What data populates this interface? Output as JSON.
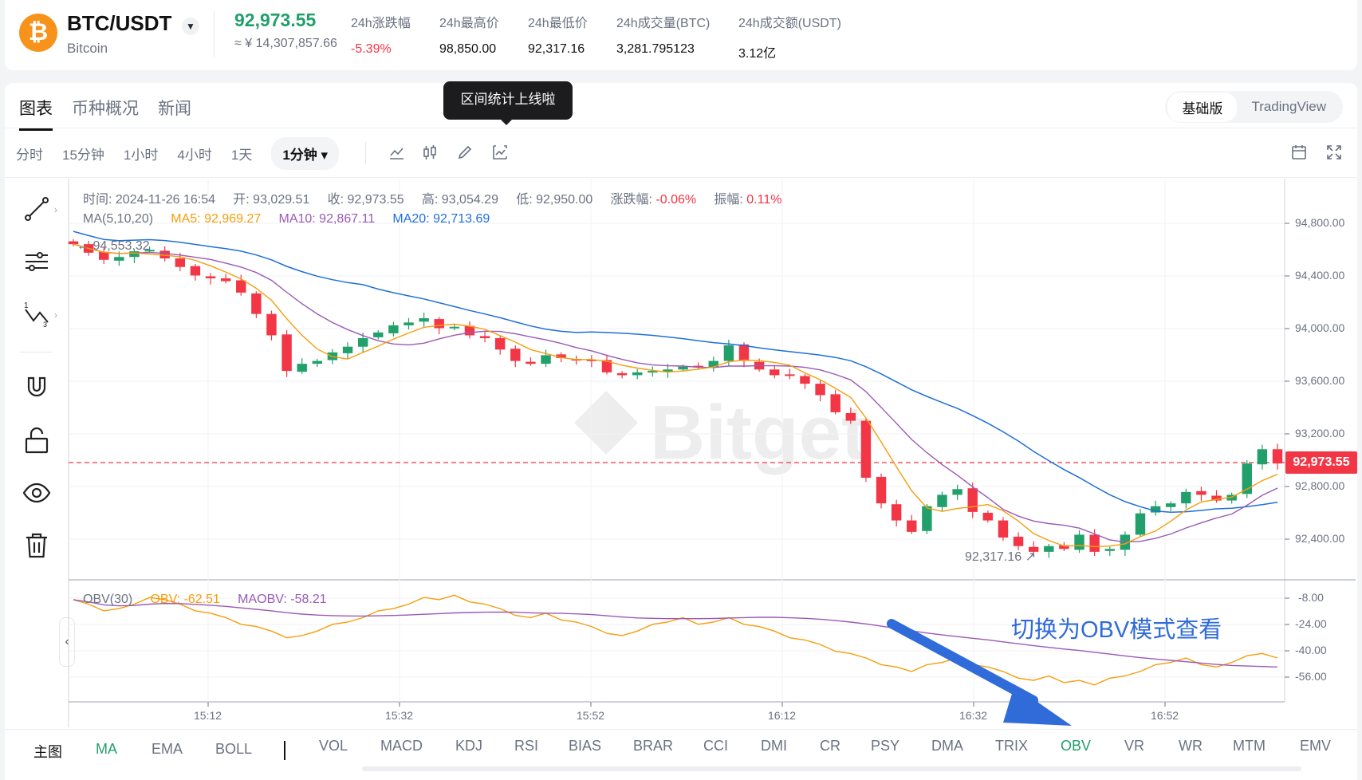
{
  "header": {
    "pair": "BTC/USDT",
    "coin_name": "Bitcoin",
    "last_price": "92,973.55",
    "price_cny": "≈ ¥ 14,307,857.66",
    "stats": [
      {
        "label": "24h涨跌幅",
        "value": "-5.39%",
        "negative": true
      },
      {
        "label": "24h最高价",
        "value": "98,850.00"
      },
      {
        "label": "24h最低价",
        "value": "92,317.16"
      },
      {
        "label": "24h成交量(BTC)",
        "value": "3,281.795123"
      },
      {
        "label": "24h成交额(USDT)",
        "value": "3.12亿"
      }
    ],
    "coin_symbol": "₿"
  },
  "tabs": [
    "图表",
    "币种概况",
    "新闻"
  ],
  "tooltip": "区间统计上线啦",
  "version_switch": [
    "基础版",
    "TradingView"
  ],
  "intervals": [
    "分时",
    "15分钟",
    "1小时",
    "4小时",
    "1天",
    "1分钟"
  ],
  "legend": {
    "time": "时间: 2024-11-26 16:54",
    "open": "开: 93,029.51",
    "close": "收: 92,973.55",
    "high": "高: 93,054.29",
    "low": "低: 92,950.00",
    "change_label": "涨跌幅: ",
    "change_value": "-0.06%",
    "amplitude_label": "振幅: ",
    "amplitude_value": "0.11%",
    "ma_title": "MA(5,10,20)",
    "ma5": "MA5: 92,969.27",
    "ma10": "MA10: 92,867.11",
    "ma20": "MA20: 92,713.69",
    "obv_title": "OBV(30)",
    "obv": "OBV: -62.51",
    "maobv": "MAOBV: -58.21"
  },
  "price_axis": [
    "94,800.00",
    "94,400.00",
    "94,000.00",
    "93,600.00",
    "93,200.00",
    "92,800.00",
    "92,400.00"
  ],
  "obv_axis": [
    "-8.00",
    "-24.00",
    "-40.00",
    "-56.00"
  ],
  "time_axis": [
    "15:12",
    "15:32",
    "15:52",
    "16:12",
    "16:32",
    "16:52"
  ],
  "current_price_tag": "92,973.55",
  "high_marker": "94,553.32",
  "low_marker": "92,317.16",
  "annotation": "切换为OBV模式查看",
  "indicators": {
    "main_label": "主图",
    "main": [
      "MA",
      "EMA",
      "BOLL"
    ],
    "sub": [
      "VOL",
      "MACD",
      "KDJ",
      "RSI",
      "BIAS",
      "BRAR",
      "CCI",
      "DMI",
      "CR",
      "PSY",
      "DMA",
      "TRIX",
      "OBV",
      "VR",
      "WR",
      "MTM",
      "EMV"
    ],
    "active_main": "MA",
    "active_sub": "OBV"
  },
  "colors": {
    "up": "#22a06b",
    "down": "#f23645",
    "ma5": "#f59e0b",
    "ma10": "#9b59b6",
    "ma20": "#1e6fd9",
    "annotation": "#2f6bd9"
  },
  "chart_data": {
    "type": "candlestick",
    "interval": "1分钟",
    "ylim": [
      92200,
      95000
    ],
    "close_series": [
      94540,
      94480,
      94430,
      94450,
      94490,
      94500,
      94440,
      94380,
      94320,
      94300,
      94280,
      94200,
      94050,
      93900,
      93650,
      93700,
      93720,
      93780,
      93820,
      93880,
      93920,
      93970,
      93990,
      94020,
      93950,
      93960,
      93900,
      93880,
      93800,
      93720,
      93700,
      93760,
      93740,
      93730,
      93720,
      93640,
      93620,
      93640,
      93650,
      93660,
      93680,
      93680,
      93720,
      93830,
      93720,
      93660,
      93620,
      93620,
      93560,
      93480,
      93360,
      93300,
      92900,
      92720,
      92600,
      92520,
      92700,
      92780,
      92820,
      92660,
      92600,
      92480,
      92420,
      92380,
      92420,
      92400,
      92500,
      92380,
      92400,
      92500,
      92650,
      92700,
      92720,
      92800,
      92780,
      92740,
      92780,
      93000,
      93100,
      93000
    ],
    "ma5_last": 92969.27,
    "ma10_last": 92867.11,
    "ma20_last": 92713.69,
    "obv_last": -62.51,
    "maobv_last": -58.21
  }
}
